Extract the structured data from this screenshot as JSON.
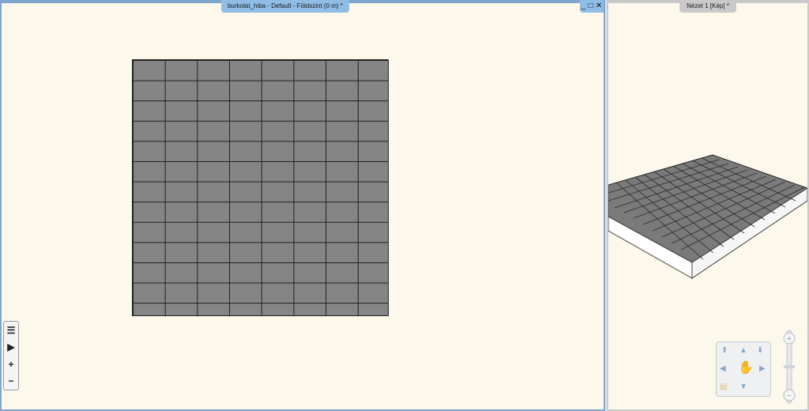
{
  "plan_view": {
    "tab_title": "burkolat_hiba - Default - Földszint (0 m) *",
    "controls": {
      "minimize": "_",
      "maximize": "□",
      "close": "✕"
    },
    "toolbar": {
      "list_icon": "list-icon",
      "play_icon": "play-icon",
      "zoom_in": "+",
      "zoom_out": "−"
    }
  },
  "view_3d": {
    "tab_title": "Nézet 1 [Kép] *",
    "nav_icons": [
      "arrow-up-icon",
      "arrow-down-icon",
      "arrow-left-icon",
      "arrow-right-icon",
      "hand-icon",
      "zoom-plus-icon",
      "zoom-minus-icon"
    ]
  },
  "colors": {
    "background": "#fdf8ec",
    "tile": "#858585",
    "grout": "#1f1f1f",
    "active_border": "#7ea6cc",
    "inactive_border": "#c9c9c9"
  }
}
